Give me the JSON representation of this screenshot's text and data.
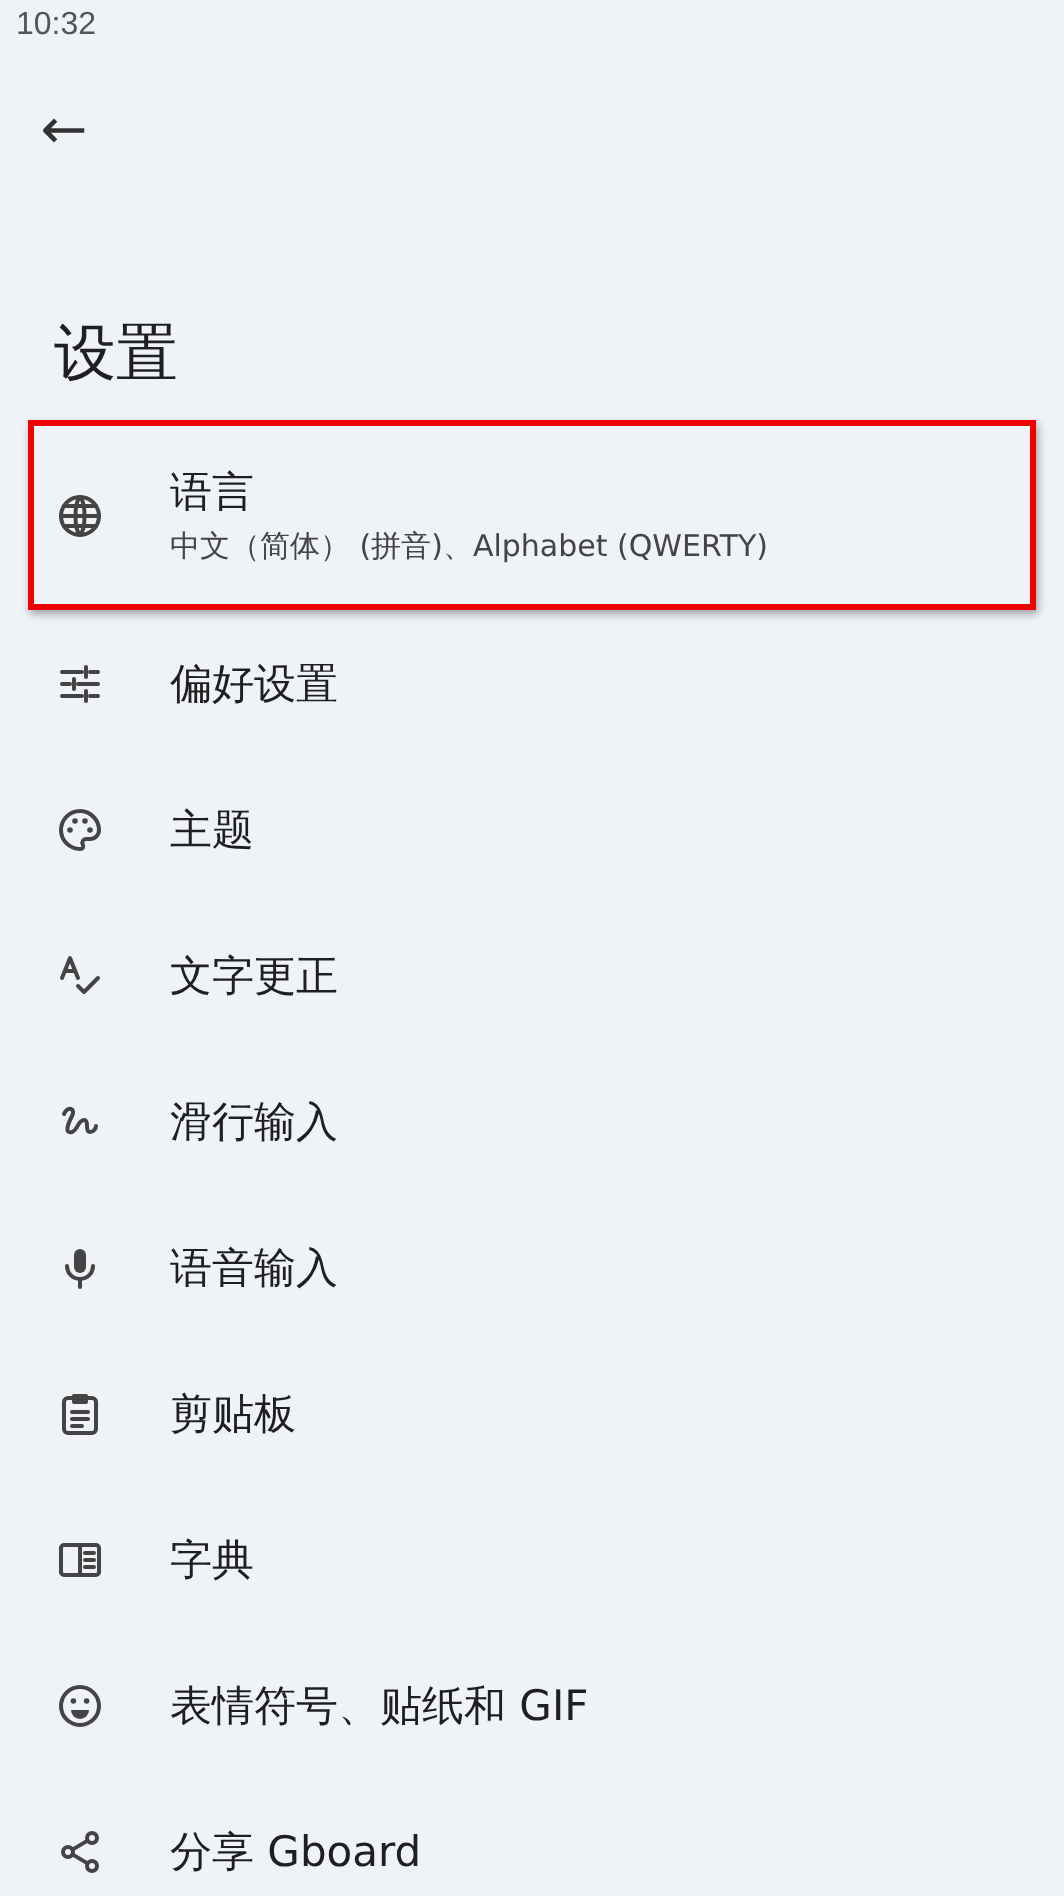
{
  "status_bar": {
    "time": "10:32"
  },
  "header": {
    "back": "←",
    "title": "设置"
  },
  "items": [
    {
      "title": "语言",
      "subtitle": "中文（简体） (拼音)、Alphabet (QWERTY)",
      "highlighted": true
    },
    {
      "title": "偏好设置",
      "highlighted": false
    },
    {
      "title": "主题",
      "highlighted": false
    },
    {
      "title": "文字更正",
      "highlighted": false
    },
    {
      "title": "滑行输入",
      "highlighted": false
    },
    {
      "title": "语音输入",
      "highlighted": false
    },
    {
      "title": "剪贴板",
      "highlighted": false
    },
    {
      "title": "字典",
      "highlighted": false
    },
    {
      "title": "表情符号、贴纸和 GIF",
      "highlighted": false
    },
    {
      "title": "分享 Gboard",
      "highlighted": false
    }
  ]
}
